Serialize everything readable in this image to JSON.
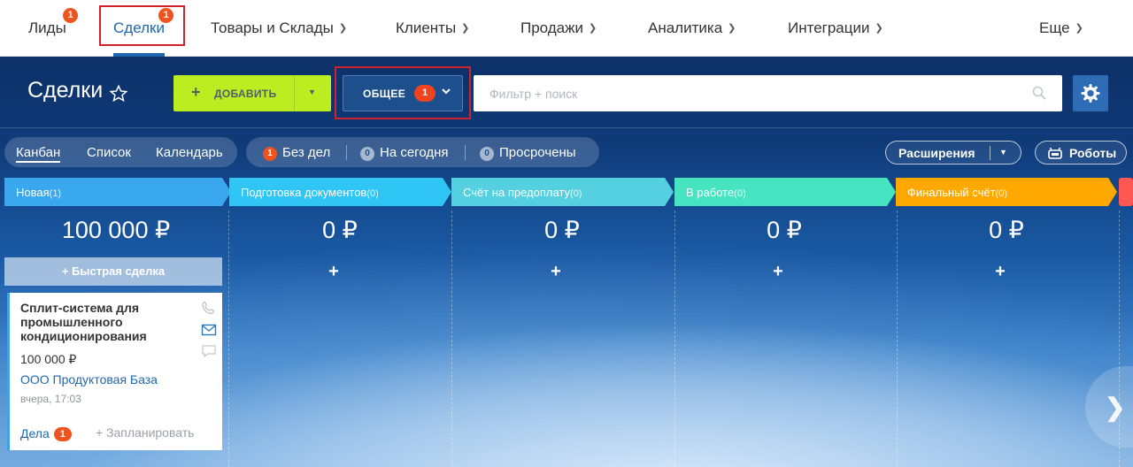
{
  "topnav": {
    "items": [
      {
        "label": "Лиды",
        "badge": "1"
      },
      {
        "label": "Сделки",
        "badge": "1"
      },
      {
        "label": "Товары и Склады"
      },
      {
        "label": "Клиенты"
      },
      {
        "label": "Продажи"
      },
      {
        "label": "Аналитика"
      },
      {
        "label": "Интеграции"
      },
      {
        "label": "Еще"
      }
    ]
  },
  "header": {
    "title": "Сделки",
    "add_label": "ДОБАВИТЬ",
    "category_label": "ОБЩЕЕ",
    "category_badge": "1",
    "search_placeholder": "Фильтр + поиск"
  },
  "views": {
    "tabs": [
      "Канбан",
      "Список",
      "Календарь"
    ],
    "active": "Канбан"
  },
  "counters": [
    {
      "badge": "1",
      "label": "Без дел"
    },
    {
      "badge": "0",
      "label": "На сегодня"
    },
    {
      "badge": "0",
      "label": "Просрочены"
    }
  ],
  "toolbar": {
    "extensions_label": "Расширения",
    "robots_label": "Роботы"
  },
  "stages": [
    {
      "name": "Новая",
      "count": "(1)",
      "sum": "100 000 ₽",
      "color": "#39a8ef"
    },
    {
      "name": "Подготовка документов",
      "count": "(0)",
      "sum": "0 ₽",
      "color": "#2fc6f6"
    },
    {
      "name": "Счёт на предоплату",
      "count": "(0)",
      "sum": "0 ₽",
      "color": "#55d0e0"
    },
    {
      "name": "В работе",
      "count": "(0)",
      "sum": "0 ₽",
      "color": "#47e4c2"
    },
    {
      "name": "Финальный счёт",
      "count": "(0)",
      "sum": "0 ₽",
      "color": "#ffa900"
    }
  ],
  "quick_deal_label": "+ Быстрая сделка",
  "deal_card": {
    "title": "Сплит-система для промышленного кондиционирования",
    "sum": "100 000 ₽",
    "company": "ООО Продуктовая База",
    "date": "вчера, 17:03",
    "tasks_label": "Дела",
    "tasks_badge": "1",
    "plan_label": "+ Запланировать"
  }
}
